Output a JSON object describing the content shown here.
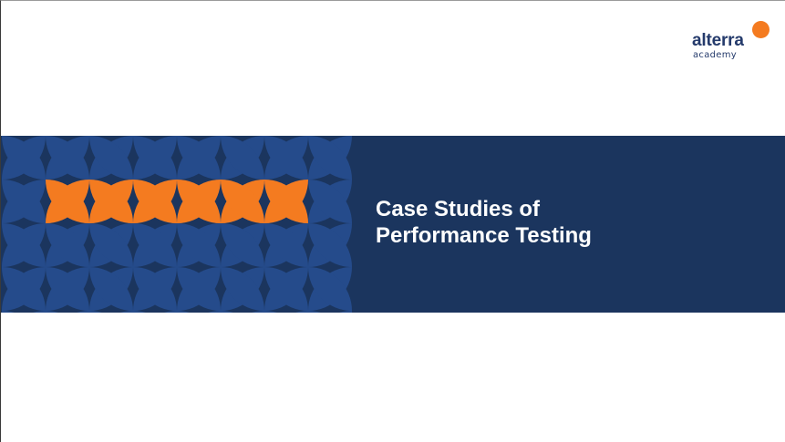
{
  "colors": {
    "navy": "#1b355e",
    "pattern_blue": "#254b8b",
    "orange": "#f47b20",
    "logo_text": "#243a6b",
    "white": "#ffffff"
  },
  "logo": {
    "word": "alterra",
    "sub": "academy",
    "icon": "orange-dot"
  },
  "title": {
    "line1": "Case Studies of",
    "line2": "Performance Testing"
  }
}
